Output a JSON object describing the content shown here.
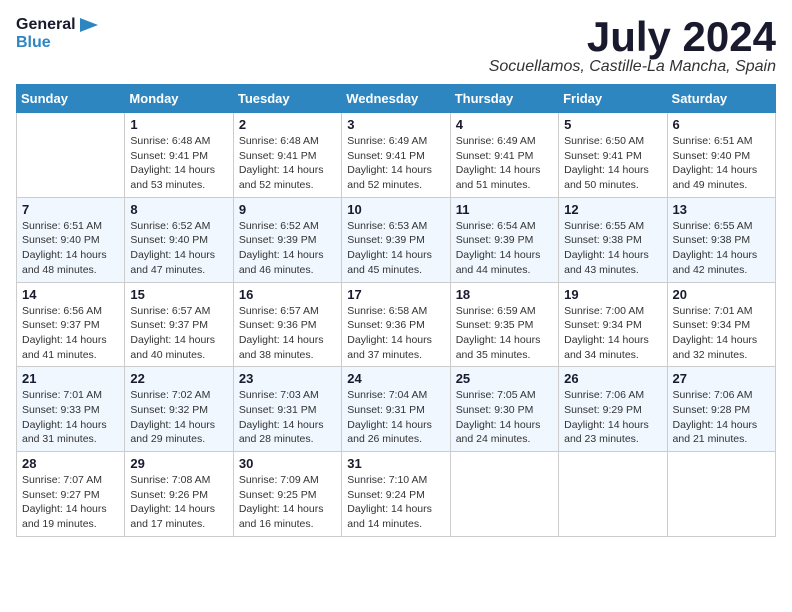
{
  "header": {
    "logo_line1": "General",
    "logo_line2": "Blue",
    "month_title": "July 2024",
    "location": "Socuellamos, Castille-La Mancha, Spain"
  },
  "weekdays": [
    "Sunday",
    "Monday",
    "Tuesday",
    "Wednesday",
    "Thursday",
    "Friday",
    "Saturday"
  ],
  "weeks": [
    [
      {
        "day": "",
        "content": ""
      },
      {
        "day": "1",
        "content": "Sunrise: 6:48 AM\nSunset: 9:41 PM\nDaylight: 14 hours\nand 53 minutes."
      },
      {
        "day": "2",
        "content": "Sunrise: 6:48 AM\nSunset: 9:41 PM\nDaylight: 14 hours\nand 52 minutes."
      },
      {
        "day": "3",
        "content": "Sunrise: 6:49 AM\nSunset: 9:41 PM\nDaylight: 14 hours\nand 52 minutes."
      },
      {
        "day": "4",
        "content": "Sunrise: 6:49 AM\nSunset: 9:41 PM\nDaylight: 14 hours\nand 51 minutes."
      },
      {
        "day": "5",
        "content": "Sunrise: 6:50 AM\nSunset: 9:41 PM\nDaylight: 14 hours\nand 50 minutes."
      },
      {
        "day": "6",
        "content": "Sunrise: 6:51 AM\nSunset: 9:40 PM\nDaylight: 14 hours\nand 49 minutes."
      }
    ],
    [
      {
        "day": "7",
        "content": "Sunrise: 6:51 AM\nSunset: 9:40 PM\nDaylight: 14 hours\nand 48 minutes."
      },
      {
        "day": "8",
        "content": "Sunrise: 6:52 AM\nSunset: 9:40 PM\nDaylight: 14 hours\nand 47 minutes."
      },
      {
        "day": "9",
        "content": "Sunrise: 6:52 AM\nSunset: 9:39 PM\nDaylight: 14 hours\nand 46 minutes."
      },
      {
        "day": "10",
        "content": "Sunrise: 6:53 AM\nSunset: 9:39 PM\nDaylight: 14 hours\nand 45 minutes."
      },
      {
        "day": "11",
        "content": "Sunrise: 6:54 AM\nSunset: 9:39 PM\nDaylight: 14 hours\nand 44 minutes."
      },
      {
        "day": "12",
        "content": "Sunrise: 6:55 AM\nSunset: 9:38 PM\nDaylight: 14 hours\nand 43 minutes."
      },
      {
        "day": "13",
        "content": "Sunrise: 6:55 AM\nSunset: 9:38 PM\nDaylight: 14 hours\nand 42 minutes."
      }
    ],
    [
      {
        "day": "14",
        "content": "Sunrise: 6:56 AM\nSunset: 9:37 PM\nDaylight: 14 hours\nand 41 minutes."
      },
      {
        "day": "15",
        "content": "Sunrise: 6:57 AM\nSunset: 9:37 PM\nDaylight: 14 hours\nand 40 minutes."
      },
      {
        "day": "16",
        "content": "Sunrise: 6:57 AM\nSunset: 9:36 PM\nDaylight: 14 hours\nand 38 minutes."
      },
      {
        "day": "17",
        "content": "Sunrise: 6:58 AM\nSunset: 9:36 PM\nDaylight: 14 hours\nand 37 minutes."
      },
      {
        "day": "18",
        "content": "Sunrise: 6:59 AM\nSunset: 9:35 PM\nDaylight: 14 hours\nand 35 minutes."
      },
      {
        "day": "19",
        "content": "Sunrise: 7:00 AM\nSunset: 9:34 PM\nDaylight: 14 hours\nand 34 minutes."
      },
      {
        "day": "20",
        "content": "Sunrise: 7:01 AM\nSunset: 9:34 PM\nDaylight: 14 hours\nand 32 minutes."
      }
    ],
    [
      {
        "day": "21",
        "content": "Sunrise: 7:01 AM\nSunset: 9:33 PM\nDaylight: 14 hours\nand 31 minutes."
      },
      {
        "day": "22",
        "content": "Sunrise: 7:02 AM\nSunset: 9:32 PM\nDaylight: 14 hours\nand 29 minutes."
      },
      {
        "day": "23",
        "content": "Sunrise: 7:03 AM\nSunset: 9:31 PM\nDaylight: 14 hours\nand 28 minutes."
      },
      {
        "day": "24",
        "content": "Sunrise: 7:04 AM\nSunset: 9:31 PM\nDaylight: 14 hours\nand 26 minutes."
      },
      {
        "day": "25",
        "content": "Sunrise: 7:05 AM\nSunset: 9:30 PM\nDaylight: 14 hours\nand 24 minutes."
      },
      {
        "day": "26",
        "content": "Sunrise: 7:06 AM\nSunset: 9:29 PM\nDaylight: 14 hours\nand 23 minutes."
      },
      {
        "day": "27",
        "content": "Sunrise: 7:06 AM\nSunset: 9:28 PM\nDaylight: 14 hours\nand 21 minutes."
      }
    ],
    [
      {
        "day": "28",
        "content": "Sunrise: 7:07 AM\nSunset: 9:27 PM\nDaylight: 14 hours\nand 19 minutes."
      },
      {
        "day": "29",
        "content": "Sunrise: 7:08 AM\nSunset: 9:26 PM\nDaylight: 14 hours\nand 17 minutes."
      },
      {
        "day": "30",
        "content": "Sunrise: 7:09 AM\nSunset: 9:25 PM\nDaylight: 14 hours\nand 16 minutes."
      },
      {
        "day": "31",
        "content": "Sunrise: 7:10 AM\nSunset: 9:24 PM\nDaylight: 14 hours\nand 14 minutes."
      },
      {
        "day": "",
        "content": ""
      },
      {
        "day": "",
        "content": ""
      },
      {
        "day": "",
        "content": ""
      }
    ]
  ]
}
